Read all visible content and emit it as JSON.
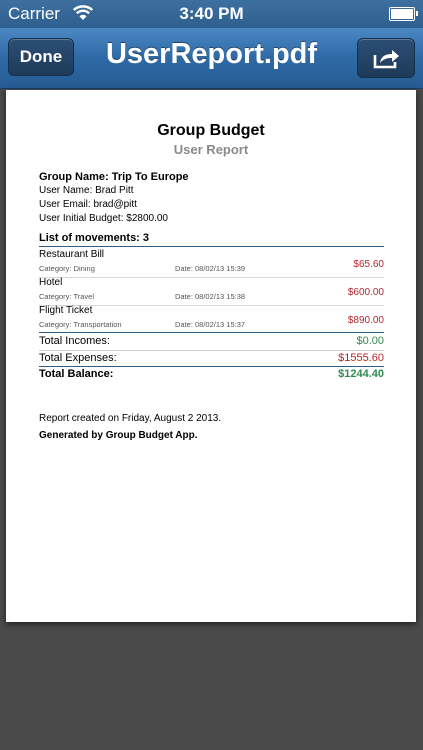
{
  "statusbar": {
    "carrier": "Carrier",
    "time": "3:40 PM"
  },
  "navbar": {
    "done_label": "Done",
    "title": "UserReport.pdf"
  },
  "report": {
    "title": "Group Budget",
    "subtitle": "User Report",
    "group_name": "Group Name: Trip To Europe",
    "user_name": "User Name: Brad Pitt",
    "user_email": "User Email: brad@pitt",
    "initial_budget": "User Initial Budget: $2800.00",
    "movements_header": "List of  movements: 3",
    "movements": [
      {
        "name": "Restaurant Bill",
        "category": "Category: Dining",
        "date": "Date: 08/02/13 15:39",
        "amount": "$65.60"
      },
      {
        "name": "Hotel",
        "category": "Category: Travel",
        "date": "Date: 08/02/13 15:38",
        "amount": "$600.00"
      },
      {
        "name": "Flight Ticket",
        "category": "Category: Transportation",
        "date": "Date: 08/02/13 15:37",
        "amount": "$890.00"
      }
    ],
    "total_incomes_label": "Total Incomes:",
    "total_incomes_value": "$0.00",
    "total_expenses_label": "Total Expenses:",
    "total_expenses_value": "$1555.60",
    "total_balance_label": "Total Balance:",
    "total_balance_value": "$1244.40",
    "footer_created": "Report created on Friday, August 2 2013.",
    "footer_generated": "Generated by Group Budget App."
  },
  "colors": {
    "navbar": "#2f6aa6",
    "income": "#2f8a4f",
    "expense": "#b0282f",
    "rule": "#2e5e86"
  },
  "icons": {
    "share": "share-icon",
    "wifi": "wifi-icon",
    "battery": "battery-icon"
  }
}
